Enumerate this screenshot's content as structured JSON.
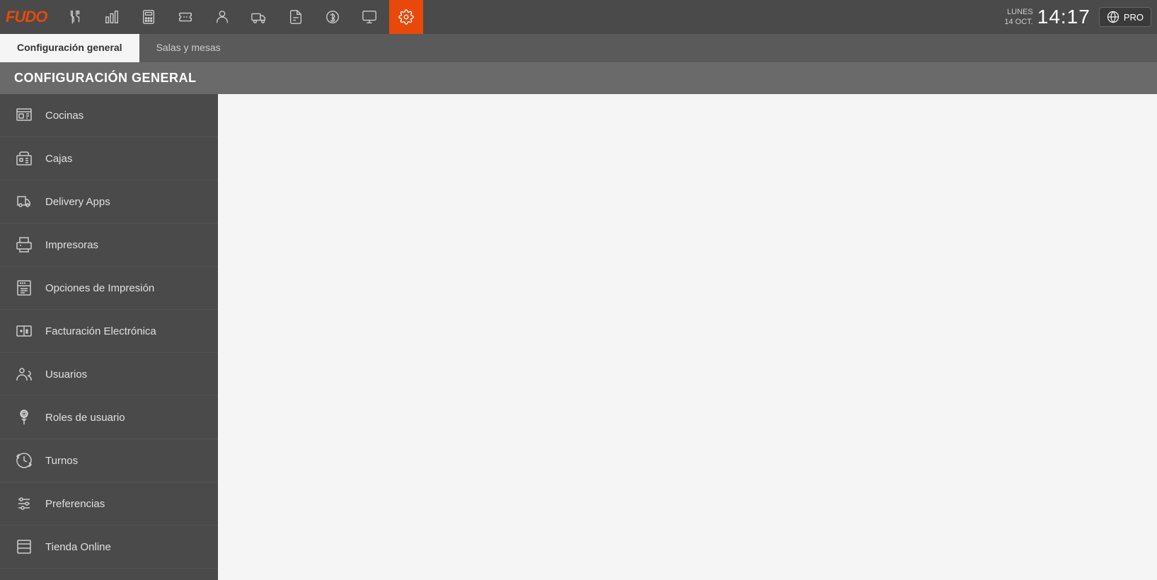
{
  "app": {
    "logo_text": "FUDO",
    "clock": {
      "day": "LUNES",
      "date": "14 OCT.",
      "time": "14:17"
    },
    "pro_label": "PRO"
  },
  "tabs": [
    {
      "id": "configuracion-general",
      "label": "Configuración general",
      "active": true
    },
    {
      "id": "salas-mesas",
      "label": "Salas y mesas",
      "active": false
    }
  ],
  "page_title": "CONFIGURACIÓN GENERAL",
  "sidebar": {
    "items": [
      {
        "id": "cocinas",
        "label": "Cocinas",
        "icon": "kitchen-icon"
      },
      {
        "id": "cajas",
        "label": "Cajas",
        "icon": "cash-register-icon"
      },
      {
        "id": "delivery-apps",
        "label": "Delivery Apps",
        "icon": "delivery-icon"
      },
      {
        "id": "impresoras",
        "label": "Impresoras",
        "icon": "printer-icon"
      },
      {
        "id": "opciones-impresion",
        "label": "Opciones de Impresión",
        "icon": "print-options-icon"
      },
      {
        "id": "facturacion-electronica",
        "label": "Facturación Electrónica",
        "icon": "invoice-icon"
      },
      {
        "id": "usuarios",
        "label": "Usuarios",
        "icon": "users-icon"
      },
      {
        "id": "roles-usuario",
        "label": "Roles de usuario",
        "icon": "roles-icon"
      },
      {
        "id": "turnos",
        "label": "Turnos",
        "icon": "shifts-icon"
      },
      {
        "id": "preferencias",
        "label": "Preferencias",
        "icon": "preferences-icon"
      },
      {
        "id": "tienda-online",
        "label": "Tienda Online",
        "icon": "store-icon"
      }
    ]
  },
  "nav_icons": [
    {
      "id": "utensils",
      "label": "Utensils"
    },
    {
      "id": "chart",
      "label": "Chart"
    },
    {
      "id": "calculator",
      "label": "Calculator"
    },
    {
      "id": "ticket",
      "label": "Ticket"
    },
    {
      "id": "person",
      "label": "Person"
    },
    {
      "id": "delivery-truck",
      "label": "Delivery Truck"
    },
    {
      "id": "document",
      "label": "Document"
    },
    {
      "id": "dollar",
      "label": "Dollar"
    },
    {
      "id": "monitor",
      "label": "Monitor"
    },
    {
      "id": "gear",
      "label": "Gear"
    }
  ]
}
